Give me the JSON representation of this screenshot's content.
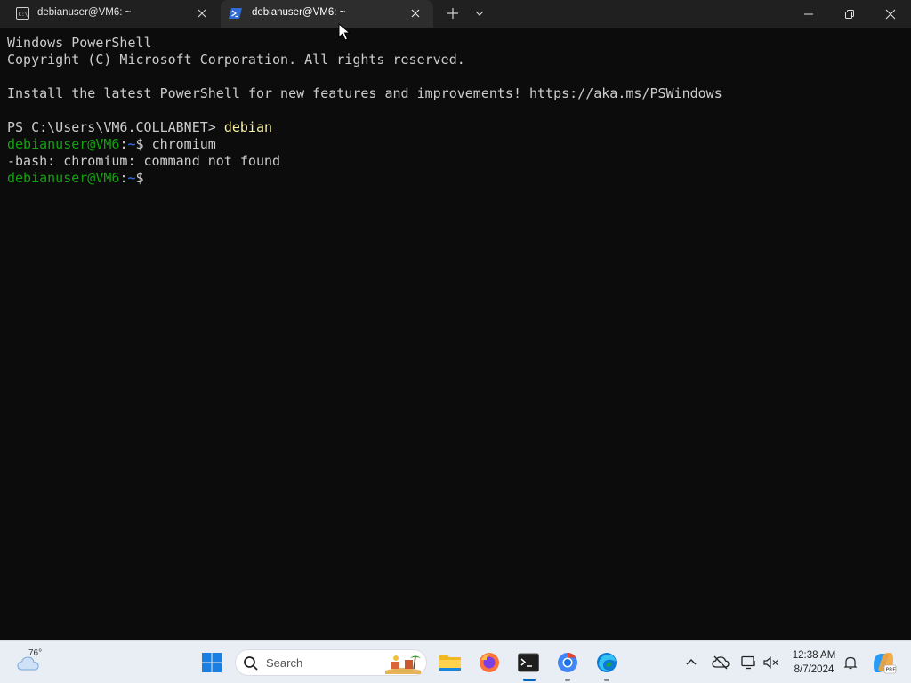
{
  "tabs": [
    {
      "title": "debianuser@VM6: ~",
      "icon": "cmd-icon",
      "active": false
    },
    {
      "title": "debianuser@VM6: ~",
      "icon": "powershell-icon",
      "active": true
    }
  ],
  "terminal": {
    "line1": "Windows PowerShell",
    "line2": "Copyright (C) Microsoft Corporation. All rights reserved.",
    "line3": "Install the latest PowerShell for new features and improvements! https://aka.ms/PSWindows",
    "ps_prompt": "PS C:\\Users\\VM6.COLLABNET> ",
    "ps_command": "debian",
    "user_host": "debianuser@VM6",
    "colon": ":",
    "cwd": "~",
    "dollar": "$ ",
    "command": "chromium",
    "error": "-bash: chromium: command not found"
  },
  "taskbar": {
    "weather_temp": "76°",
    "search_label": "Search",
    "clock_time": "12:38 AM",
    "clock_date": "8/7/2024",
    "apps": [
      "file-explorer-icon",
      "firefox-icon",
      "terminal-icon",
      "chrome-icon",
      "edge-icon"
    ]
  },
  "colors": {
    "terminal_bg": "#0c0c0c",
    "prompt_green": "#13a10e",
    "path_blue": "#3b78ff",
    "command_yellow": "#f9f1a5",
    "titlebar_bg": "#202020"
  }
}
